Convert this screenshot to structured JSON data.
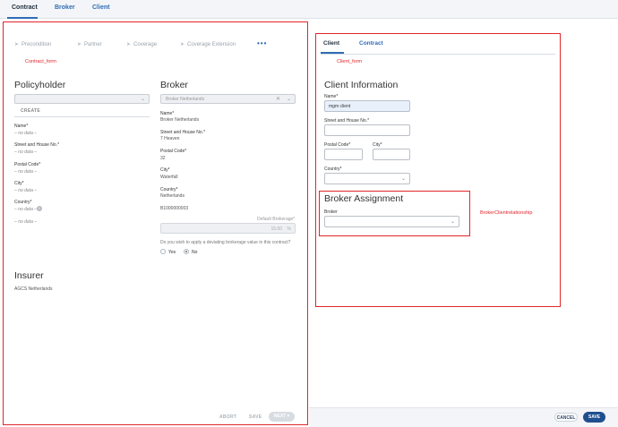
{
  "top_tabs": [
    "Contract",
    "Broker",
    "Client"
  ],
  "contract_form": {
    "annotation": "Contract_form",
    "steps": [
      "Precondition",
      "Partner",
      "Coverage",
      "Coverage Extension"
    ],
    "more": "•••",
    "policyholder": {
      "title": "Policyholder",
      "create": "CREATE",
      "fields": [
        {
          "label": "Name*",
          "value": "– no data –"
        },
        {
          "label": "Street and House No.*",
          "value": "– no data –"
        },
        {
          "label": "Postal Code*",
          "value": "– no data –"
        },
        {
          "label": "City*",
          "value": "– no data –"
        },
        {
          "label": "Country*",
          "value": "– no data –"
        }
      ],
      "extra_value": "– no data –",
      "info_icon": "i"
    },
    "broker": {
      "title": "Broker",
      "select_value": "Broker Netherlands",
      "fields": [
        {
          "label": "Name*",
          "value": "Broker Netherlands"
        },
        {
          "label": "Street and House No.*",
          "value": "7 Heaven"
        },
        {
          "label": "Postal Code*",
          "value": "32"
        },
        {
          "label": "City*",
          "value": "Waterfall"
        },
        {
          "label": "Country*",
          "value": "Netherlands"
        }
      ],
      "id_value": "B1000000003",
      "default_brokerage_label": "Default Brokerage*",
      "default_brokerage_value": "15.00",
      "percent": "%",
      "question": "Do you wish to apply a deviating brokerage value in this contract?",
      "yes": "Yes",
      "no": "No"
    },
    "insurer": {
      "title": "Insurer",
      "value": "AGCS Netherlands"
    },
    "footer": {
      "abort": "ABORT",
      "save": "SAVE",
      "next": "NEXT ▾"
    }
  },
  "client_form": {
    "annotation": "Client_form",
    "tabs": [
      "Client",
      "Contract"
    ],
    "title": "Client Information",
    "name_label": "Name*",
    "name_value": "mgm client",
    "street_label": "Street and House No.*",
    "postal_label": "Postal Code*",
    "city_label": "City*",
    "country_label": "Country*",
    "broker_assignment": {
      "title": "Broker Assignment",
      "broker_label": "Broker",
      "annotation": "BrokerClientrelationship"
    }
  },
  "footer": {
    "cancel": "CANCEL",
    "save": "SAVE"
  },
  "colors": {
    "accent": "#2f6db5",
    "annotation": "#e0262a",
    "primary_button": "#1f4f8f"
  }
}
